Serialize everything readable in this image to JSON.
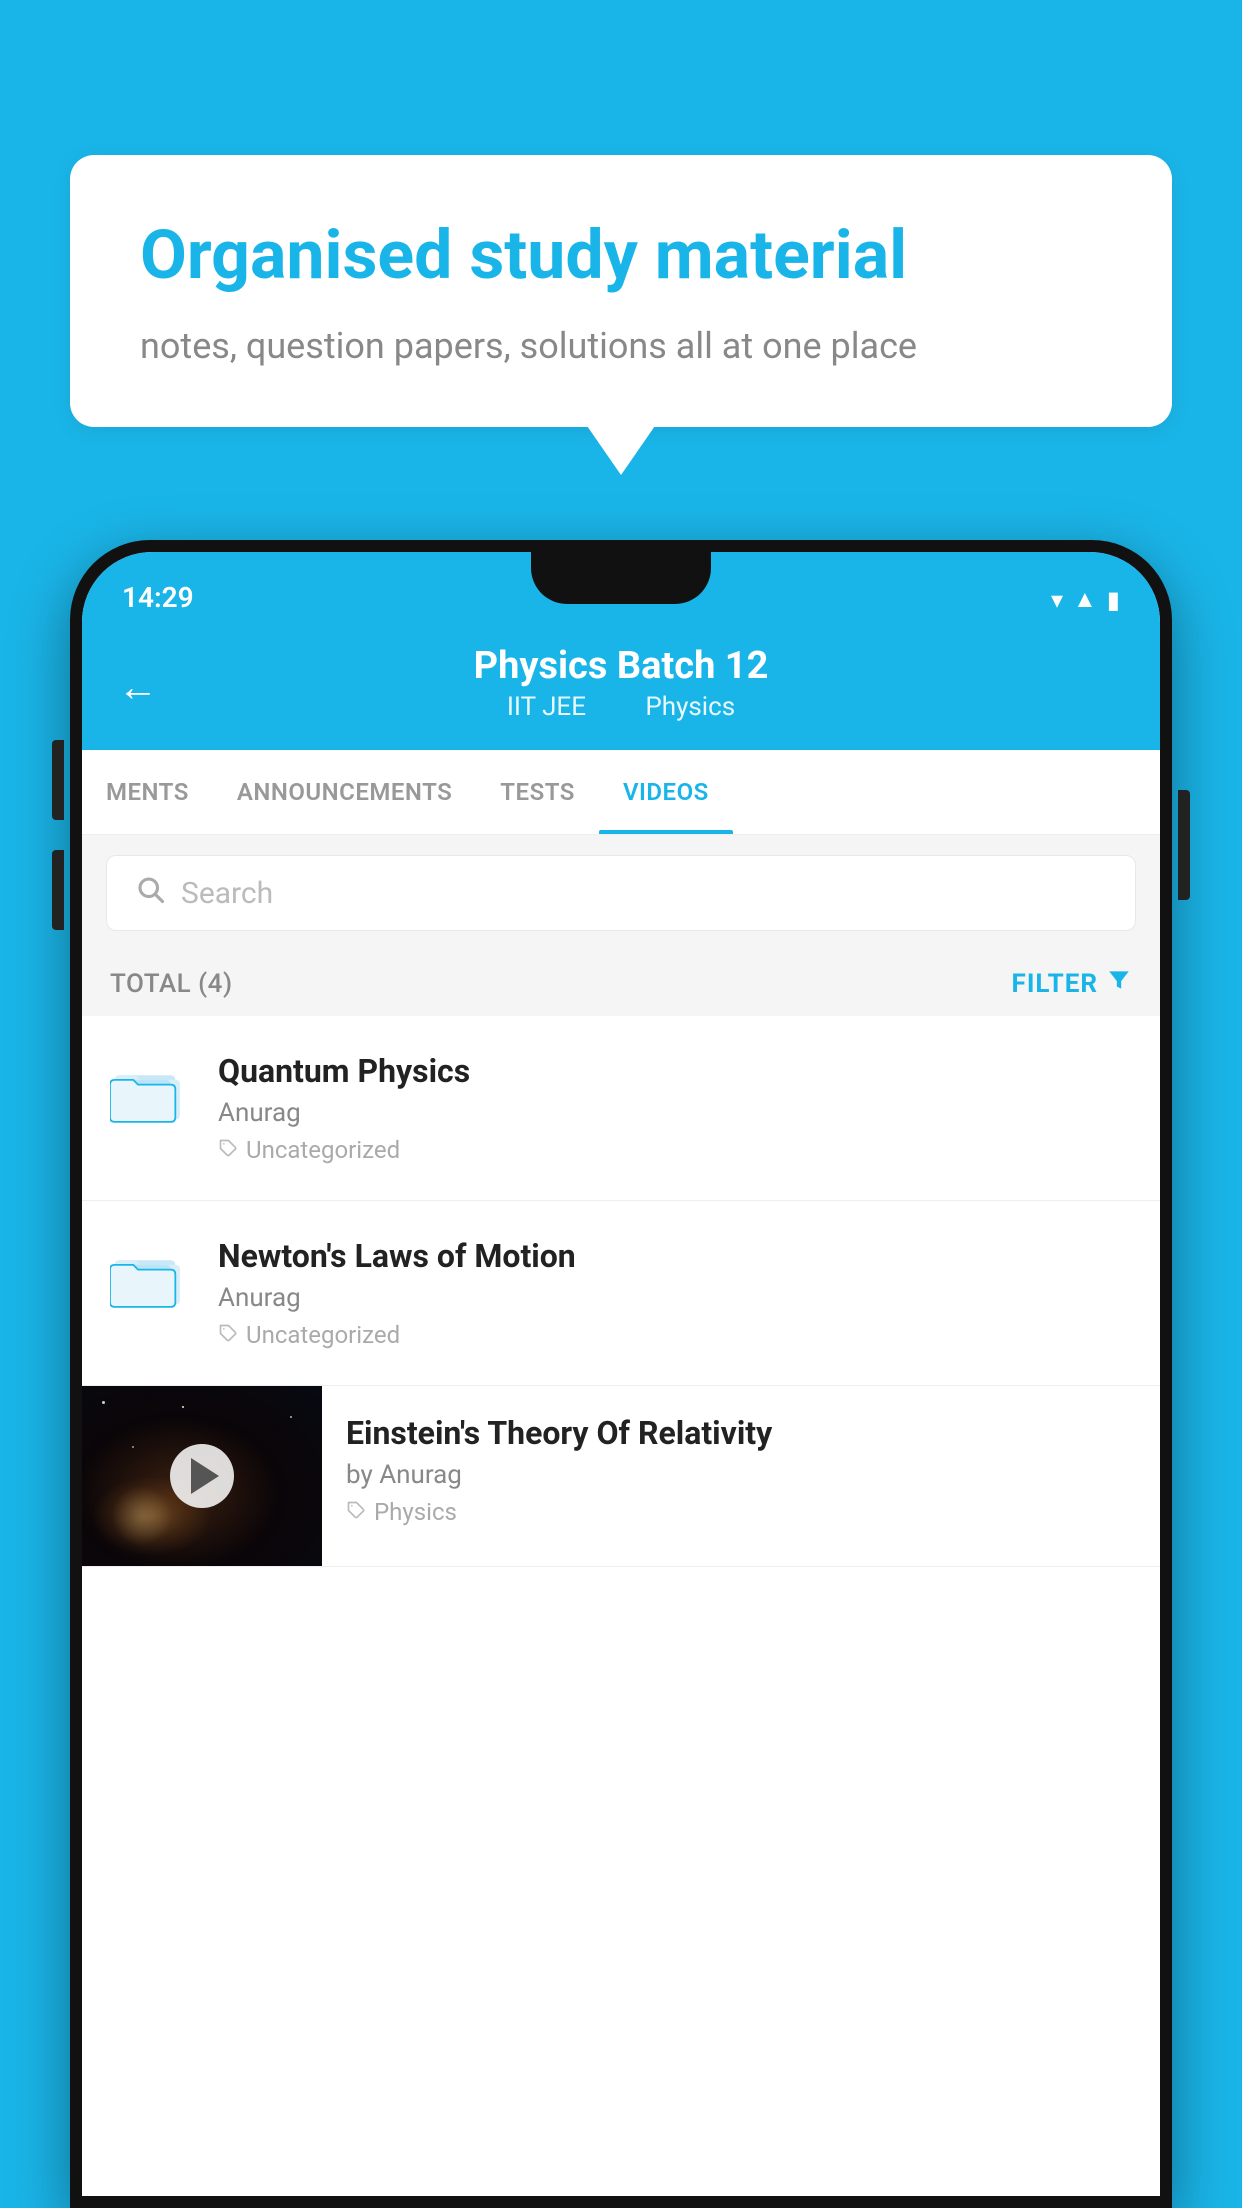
{
  "bubble": {
    "title": "Organised study material",
    "subtitle": "notes, question papers, solutions all at one place"
  },
  "statusBar": {
    "time": "14:29"
  },
  "header": {
    "title": "Physics Batch 12",
    "subtitle1": "IIT JEE",
    "subtitle2": "Physics"
  },
  "tabs": [
    {
      "label": "MENTS",
      "active": false
    },
    {
      "label": "ANNOUNCEMENTS",
      "active": false
    },
    {
      "label": "TESTS",
      "active": false
    },
    {
      "label": "VIDEOS",
      "active": true
    }
  ],
  "search": {
    "placeholder": "Search"
  },
  "filterBar": {
    "total": "TOTAL (4)",
    "filterLabel": "FILTER"
  },
  "videos": [
    {
      "title": "Quantum Physics",
      "author": "Anurag",
      "tag": "Uncategorized",
      "hasThumb": false
    },
    {
      "title": "Newton's Laws of Motion",
      "author": "Anurag",
      "tag": "Uncategorized",
      "hasThumb": false
    },
    {
      "title": "Einstein's Theory Of Relativity",
      "author": "by Anurag",
      "tag": "Physics",
      "hasThumb": true
    }
  ]
}
